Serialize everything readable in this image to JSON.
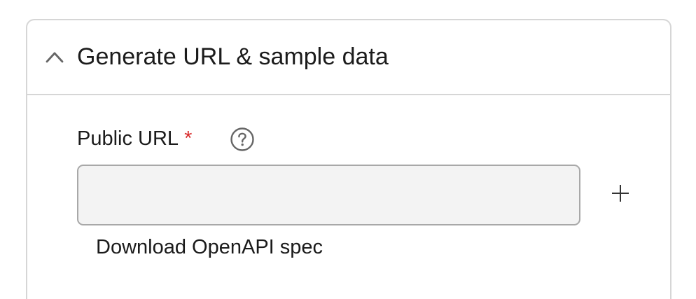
{
  "section": {
    "title": "Generate URL & sample data",
    "toggle_icon": "chevron-up-icon",
    "expanded": true
  },
  "form": {
    "public_url": {
      "label": "Public URL",
      "required_marker": "*",
      "help_icon": "question-circle-icon",
      "value": "",
      "placeholder": ""
    },
    "add_icon": "plus-icon",
    "download_link": "Download OpenAPI spec"
  },
  "colors": {
    "border": "#d6d6d6",
    "input_bg": "#f3f3f3",
    "input_border": "#a8a8a8",
    "required": "#d92c2c",
    "icon": "#666666",
    "text": "#1b1b1b"
  }
}
